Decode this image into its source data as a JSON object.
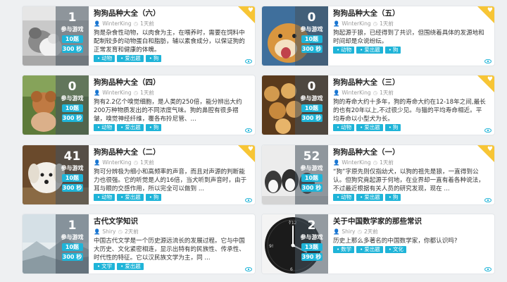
{
  "ui": {
    "join_label": "参与游戏",
    "heart_glyph": "♥"
  },
  "cards": [
    {
      "title": "狗狗品种大全（六）",
      "author": "WinterKing",
      "time": "1天前",
      "count": "1",
      "questions": "10题",
      "seconds": "300 秒",
      "desc": "狗是杂食性动物，以肉食为主，在喂养时，需要在饲料中配制较多的动物蛋白和脂肪，辅以素食成分，以保证狗的正常发育和健康的体魄。",
      "tags": [
        "动物",
        "爱出题",
        "狗"
      ],
      "favorite": true,
      "thumb": "cat-dog"
    },
    {
      "title": "狗狗品种大全（五）",
      "author": "WinterKing",
      "time": "1天前",
      "count": "0",
      "questions": "10题",
      "seconds": "300 秒",
      "desc": "狗起源于狼，已经得到了共识，但围绕着具体的发源地和时间却是众说纷纭。",
      "tags": [
        "动物",
        "爱出题",
        "狗"
      ],
      "favorite": true,
      "thumb": "shiba"
    },
    {
      "title": "狗狗品种大全（四）",
      "author": "WinterKing",
      "time": "1天前",
      "count": "0",
      "questions": "10题",
      "seconds": "300 秒",
      "desc": "狗有2.2亿个嗅觉细胞，是人类的250倍，能分辨出大约200万种物质发出的不同浓度气味。狗的鼻腔有很多褶皱，嗅觉神经纤维，覆各布拎尼管、...",
      "tags": [
        "动物",
        "爱出题",
        "狗"
      ],
      "favorite": false,
      "thumb": "poodle"
    },
    {
      "title": "狗狗品种大全（三）",
      "author": "WinterKing",
      "time": "1天前",
      "count": "0",
      "questions": "10题",
      "seconds": "300 秒",
      "desc": "狗的寿命大约十多年，狗的寿命大约在12-18年之间,最长的也有20年以上,不过很少见。与猫的平均寿命相近。平均寿命以小型犬为长。",
      "tags": [
        "动物",
        "爱出题",
        "狗"
      ],
      "favorite": true,
      "thumb": "puppies"
    },
    {
      "title": "狗狗品种大全（二）",
      "author": "WinterKing",
      "time": "1天前",
      "count": "41",
      "questions": "10题",
      "seconds": "300 秒",
      "desc": "狗可分辨极为细小和高频率的声音，而且对声源的判断能力也很强。它的听觉是人的16倍，当犬听到声音时，由于耳与眼的交感作用，所以完全可以做到 ...",
      "tags": [
        "动物",
        "爱出题",
        "狗"
      ],
      "favorite": true,
      "thumb": "white-dog"
    },
    {
      "title": "狗狗品种大全（一）",
      "author": "WinterKing",
      "time": "1天前",
      "count": "52",
      "questions": "10题",
      "seconds": "300 秒",
      "desc": "“狗”字原先则仅指幼犬，以狗的祖先是狼，一直得到公认。但狗究竟起源于何地，在业界却一直有着各种说法，不过最近根据有关人员的研究发现，现在 ...",
      "tags": [
        "动物",
        "爱出题",
        "狗"
      ],
      "favorite": true,
      "thumb": "husky"
    },
    {
      "title": "古代文学知识",
      "author": "Shiry",
      "time": "2天前",
      "count": "1",
      "questions": "10题",
      "seconds": "300 秒",
      "desc": "中国古代文学是一个历史源远流长的发展过程。它与中国大历史、文化紧密相连，显示出特有的民族性、传承性、时代性的特征。它以汉民族文学为主，同 ...",
      "tags": [
        "文学",
        "爱出题"
      ],
      "favorite": false,
      "thumb": "landscape"
    },
    {
      "title": "关于中国数学家的那些常识",
      "author": "Shiry",
      "time": "2天前",
      "count": "2",
      "questions": "13题",
      "seconds": "390 秒",
      "desc": "历史上那么多著名的中国数学家，你都认识吗?",
      "tags": [
        "数学",
        "爱出题",
        "文化"
      ],
      "favorite": false,
      "thumb": "clock"
    }
  ]
}
